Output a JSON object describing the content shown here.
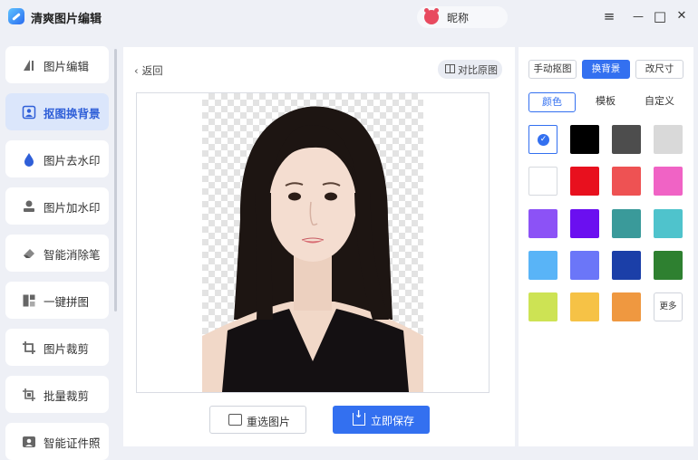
{
  "app": {
    "title": "清爽图片编辑"
  },
  "user": {
    "nickname": "昵称"
  },
  "window_controls": {
    "menu": "≡",
    "minimize": "—",
    "maximize": "□",
    "close": "✕"
  },
  "sidebar": {
    "items": [
      {
        "label": "图片编辑",
        "icon": "edit-image-icon",
        "active": false
      },
      {
        "label": "抠图换背景",
        "icon": "cutout-icon",
        "active": true
      },
      {
        "label": "图片去水印",
        "icon": "water-drop-icon",
        "active": false
      },
      {
        "label": "图片加水印",
        "icon": "stamp-icon",
        "active": false
      },
      {
        "label": "智能消除笔",
        "icon": "eraser-icon",
        "active": false
      },
      {
        "label": "一键拼图",
        "icon": "collage-icon",
        "active": false
      },
      {
        "label": "图片裁剪",
        "icon": "crop-icon",
        "active": false
      },
      {
        "label": "批量裁剪",
        "icon": "batch-crop-icon",
        "active": false
      },
      {
        "label": "智能证件照",
        "icon": "id-photo-icon",
        "active": false
      }
    ]
  },
  "main": {
    "back_label": "返回",
    "compare_label": "对比原图",
    "reselect_label": "重选图片",
    "save_label": "立即保存"
  },
  "panel": {
    "modes": [
      "手动抠图",
      "换背景",
      "改尺寸"
    ],
    "active_mode": "换背景",
    "sub_tabs": [
      "颜色",
      "模板",
      "自定义"
    ],
    "active_sub_tab": "颜色",
    "more_label": "更多",
    "colors": [
      "#ffffff",
      "#000000",
      "#4d4d4d",
      "#d9d9d9",
      "#ffffff",
      "#e8101e",
      "#ee5253",
      "#f063c5",
      "#8c52f6",
      "#6b0ff0",
      "#3a9a9a",
      "#4fc3cc",
      "#59b4f7",
      "#6b76f8",
      "#1b3fa8",
      "#2e8030",
      "#cde354",
      "#f6c246",
      "#ef9840"
    ],
    "selected_color_index": 0
  },
  "colors": {
    "accent": "#3370f0",
    "active_nav_bg": "#dbe6fb"
  }
}
